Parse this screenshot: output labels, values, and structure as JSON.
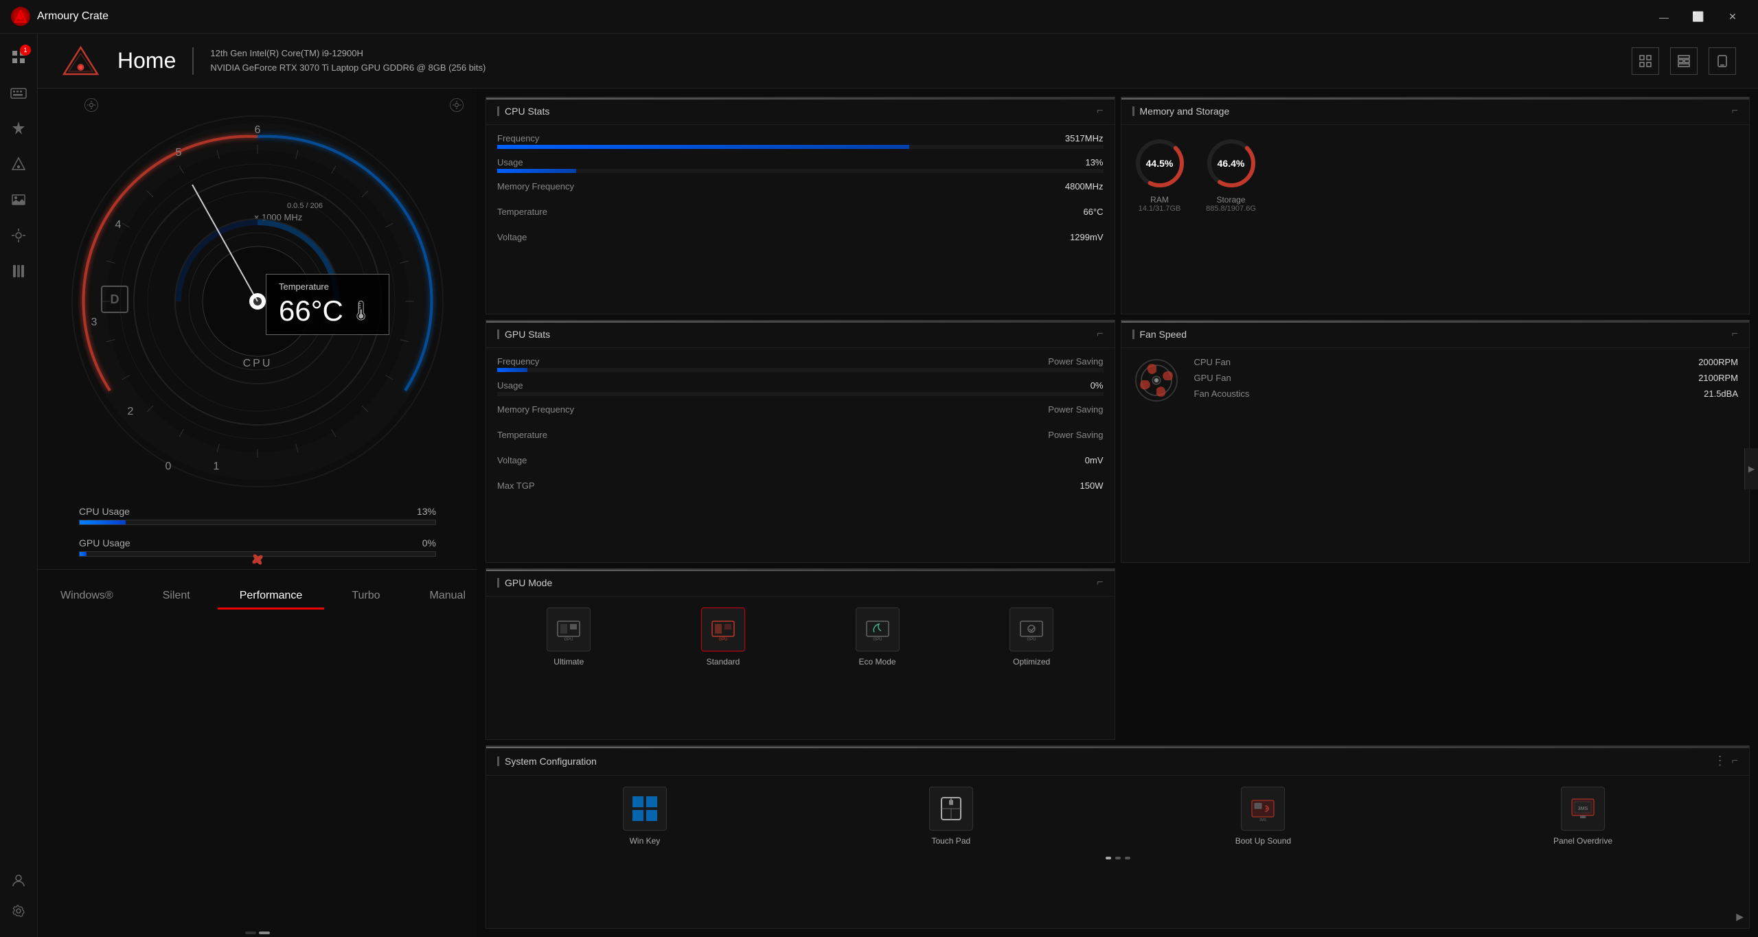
{
  "app": {
    "title": "Armoury Crate",
    "icon": "R"
  },
  "titlebar": {
    "minimize": "—",
    "maximize": "⬜",
    "close": "✕"
  },
  "header": {
    "title": "Home",
    "cpu": "12th Gen Intel(R) Core(TM) i9-12900H",
    "gpu": "NVIDIA GeForce RTX 3070 Ti Laptop GPU GDDR6 @ 8GB (256 bits)"
  },
  "sidebar": {
    "items": [
      {
        "id": "home",
        "icon": "⊞",
        "label": "Home",
        "active": true
      },
      {
        "id": "keyboard",
        "icon": "⌨",
        "label": "Keyboard"
      },
      {
        "id": "lighting",
        "icon": "◈",
        "label": "Lighting"
      },
      {
        "id": "aura",
        "icon": "✦",
        "label": "Aura"
      },
      {
        "id": "gallery",
        "icon": "🖼",
        "label": "Gallery"
      },
      {
        "id": "tools",
        "icon": "⚒",
        "label": "Tools"
      },
      {
        "id": "library",
        "icon": "📚",
        "label": "Library"
      },
      {
        "id": "settings",
        "icon": "⚙",
        "label": "Settings"
      }
    ]
  },
  "gauge": {
    "temperature_label": "Temperature",
    "temperature_value": "66°C",
    "cpu_label": "CPU",
    "scale_label": "× 1000 MHz",
    "scale_value": "0.0.5 / 206"
  },
  "usageBars": [
    {
      "label": "CPU Usage",
      "value": "13%",
      "pct": 13
    },
    {
      "label": "GPU Usage",
      "value": "0%",
      "pct": 2
    }
  ],
  "modes": [
    {
      "id": "windows",
      "label": "Windows®",
      "active": false
    },
    {
      "id": "silent",
      "label": "Silent",
      "active": false
    },
    {
      "id": "performance",
      "label": "Performance",
      "active": true
    },
    {
      "id": "turbo",
      "label": "Turbo",
      "active": false
    },
    {
      "id": "manual",
      "label": "Manual",
      "active": false
    }
  ],
  "cpuStats": {
    "title": "CPU Stats",
    "rows": [
      {
        "label": "Frequency",
        "value": "3517MHz",
        "pct": 68
      },
      {
        "label": "Usage",
        "value": "13%",
        "pct": 13
      },
      {
        "label": "Memory Frequency",
        "value": "4800MHz"
      },
      {
        "label": "Temperature",
        "value": "66°C"
      },
      {
        "label": "Voltage",
        "value": "1299mV"
      }
    ]
  },
  "memStorage": {
    "title": "Memory and Storage",
    "ram": {
      "pct": 44.5,
      "label": "RAM",
      "detail": "14.1/31.7GB"
    },
    "storage": {
      "pct": 46.4,
      "label": "Storage",
      "detail": "885.8/1907.6G"
    }
  },
  "fanSpeed": {
    "title": "Fan Speed",
    "items": [
      {
        "label": "CPU Fan",
        "value": "2000RPM"
      },
      {
        "label": "GPU Fan",
        "value": "2100RPM"
      },
      {
        "label": "Fan Acoustics",
        "value": "21.5dBA"
      }
    ]
  },
  "gpuStats": {
    "title": "GPU Stats",
    "rows": [
      {
        "label": "Frequency",
        "value": "Power Saving",
        "pct": 5
      },
      {
        "label": "Usage",
        "value": "0%",
        "pct": 0
      },
      {
        "label": "Memory Frequency",
        "value": "Power Saving"
      },
      {
        "label": "Temperature",
        "value": "Power Saving"
      },
      {
        "label": "Voltage",
        "value": "0mV"
      },
      {
        "label": "Max TGP",
        "value": "150W"
      }
    ]
  },
  "gpuMode": {
    "title": "GPU Mode",
    "modes": [
      {
        "id": "ultimate",
        "label": "Ultimate",
        "icon": "GPU",
        "active": false
      },
      {
        "id": "standard",
        "label": "Standard",
        "icon": "GPU",
        "active": true
      },
      {
        "id": "eco",
        "label": "Eco Mode",
        "icon": "GPU",
        "active": false
      },
      {
        "id": "optimized",
        "label": "Optimized",
        "icon": "GPU",
        "active": false
      }
    ]
  },
  "systemConfig": {
    "title": "System Configuration",
    "items": [
      {
        "id": "winkey",
        "label": "Win Key",
        "icon": "⊞"
      },
      {
        "id": "touchpad",
        "label": "Touch Pad",
        "icon": "▭"
      },
      {
        "id": "bootup",
        "label": "Boot Up Sound",
        "icon": "♪"
      },
      {
        "id": "panel",
        "label": "Panel Overdrive",
        "icon": "▣"
      }
    ]
  }
}
